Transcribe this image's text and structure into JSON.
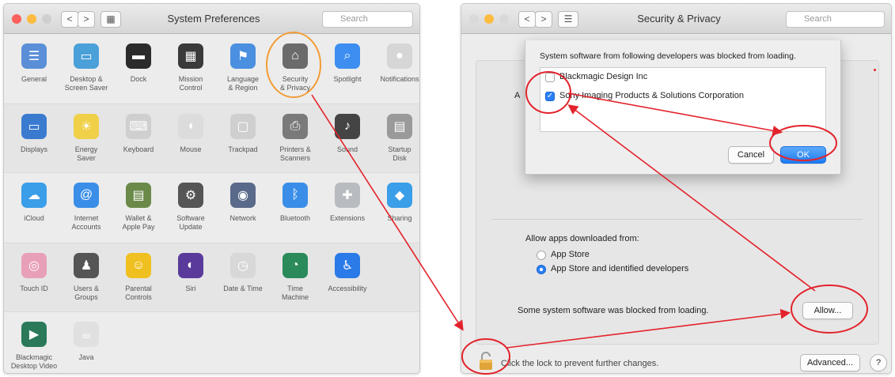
{
  "colors": {
    "close": "#fc605b",
    "minimize": "#fdbc40",
    "zoom": "#34c84a",
    "annotation_red": "#e3232c",
    "highlight_orange": "#f39c34",
    "accent_blue": "#2b7ff6"
  },
  "syspref": {
    "title": "System Preferences",
    "nav_back": "<",
    "nav_forward": ">",
    "grid_glyph": "▦",
    "search_placeholder": "Search",
    "search_icon": "search-icon",
    "rows": [
      [
        {
          "label": "General",
          "icon": "general-icon",
          "color": "#5a8fd8",
          "glyph": "☰"
        },
        {
          "label": "Desktop &\nScreen Saver",
          "icon": "desktop-icon",
          "color": "#4aa0d8",
          "glyph": "▭"
        },
        {
          "label": "Dock",
          "icon": "dock-icon",
          "color": "#2b2b2b",
          "glyph": "▬"
        },
        {
          "label": "Mission\nControl",
          "icon": "mission-control-icon",
          "color": "#3a3a3a",
          "glyph": "▦"
        },
        {
          "label": "Language\n& Region",
          "icon": "language-icon",
          "color": "#4a8fe0",
          "glyph": "⚑"
        },
        {
          "label": "Security\n& Privacy",
          "icon": "security-icon",
          "color": "#6b6b6b",
          "glyph": "⌂"
        },
        {
          "label": "Spotlight",
          "icon": "spotlight-icon",
          "color": "#3d8ef0",
          "glyph": "⌕"
        },
        {
          "label": "Notifications",
          "icon": "notifications-icon",
          "color": "#d6d6d6",
          "glyph": "●"
        }
      ],
      [
        {
          "label": "Displays",
          "icon": "displays-icon",
          "color": "#3a7bd0",
          "glyph": "▭"
        },
        {
          "label": "Energy\nSaver",
          "icon": "energy-saver-icon",
          "color": "#f0d048",
          "glyph": "☀"
        },
        {
          "label": "Keyboard",
          "icon": "keyboard-icon",
          "color": "#cfcfcf",
          "glyph": "⌨"
        },
        {
          "label": "Mouse",
          "icon": "mouse-icon",
          "color": "#dcdcdc",
          "glyph": "◖"
        },
        {
          "label": "Trackpad",
          "icon": "trackpad-icon",
          "color": "#cfcfcf",
          "glyph": "▢"
        },
        {
          "label": "Printers &\nScanners",
          "icon": "printers-icon",
          "color": "#7a7a7a",
          "glyph": "⎙"
        },
        {
          "label": "Sound",
          "icon": "sound-icon",
          "color": "#444444",
          "glyph": "♪"
        },
        {
          "label": "Startup\nDisk",
          "icon": "startup-disk-icon",
          "color": "#9a9a9a",
          "glyph": "▤"
        }
      ],
      [
        {
          "label": "iCloud",
          "icon": "icloud-icon",
          "color": "#3a9ee8",
          "glyph": "☁"
        },
        {
          "label": "Internet\nAccounts",
          "icon": "internet-accounts-icon",
          "color": "#3a8ee8",
          "glyph": "@"
        },
        {
          "label": "Wallet &\nApple Pay",
          "icon": "wallet-icon",
          "color": "#6b8a4a",
          "glyph": "▤"
        },
        {
          "label": "Software\nUpdate",
          "icon": "software-update-icon",
          "color": "#555555",
          "glyph": "⚙"
        },
        {
          "label": "Network",
          "icon": "network-icon",
          "color": "#5a6a8a",
          "glyph": "◉"
        },
        {
          "label": "Bluetooth",
          "icon": "bluetooth-icon",
          "color": "#3a8ee8",
          "glyph": "ᛒ"
        },
        {
          "label": "Extensions",
          "icon": "extensions-icon",
          "color": "#b8bcc0",
          "glyph": "✚"
        },
        {
          "label": "Sharing",
          "icon": "sharing-icon",
          "color": "#3a9ee8",
          "glyph": "◆"
        }
      ],
      [
        {
          "label": "Touch ID",
          "icon": "touch-id-icon",
          "color": "#e8a0b8",
          "glyph": "◎"
        },
        {
          "label": "Users &\nGroups",
          "icon": "users-icon",
          "color": "#555555",
          "glyph": "♟"
        },
        {
          "label": "Parental\nControls",
          "icon": "parental-controls-icon",
          "color": "#f0c020",
          "glyph": "☺"
        },
        {
          "label": "Siri",
          "icon": "siri-icon",
          "color": "#5a3a9a",
          "glyph": "◐"
        },
        {
          "label": "Date & Time",
          "icon": "date-time-icon",
          "color": "#d8d8d8",
          "glyph": "◷"
        },
        {
          "label": "Time\nMachine",
          "icon": "time-machine-icon",
          "color": "#2a8a5a",
          "glyph": "◔"
        },
        {
          "label": "Accessibility",
          "icon": "accessibility-icon",
          "color": "#2a7ae8",
          "glyph": "♿"
        }
      ],
      [
        {
          "label": "Blackmagic\nDesktop Video",
          "icon": "blackmagic-icon",
          "color": "#2a7a5a",
          "glyph": "▶"
        },
        {
          "label": "Java",
          "icon": "java-icon",
          "color": "#e0e0e0",
          "glyph": "☕"
        }
      ]
    ]
  },
  "security": {
    "title": "Security & Privacy",
    "nav_back": "<",
    "nav_forward": ">",
    "grid_glyph": "☰",
    "search_placeholder": "Search",
    "search_icon": "search-icon",
    "panel_letter": "A",
    "allow_apps_label": "Allow apps downloaded from:",
    "radio_app_store": "App Store",
    "radio_identified": "App Store and identified developers",
    "blocked_text": "Some system software was blocked from loading.",
    "allow_button": "Allow...",
    "lock_text": "Click the lock to prevent further changes.",
    "advanced_button": "Advanced...",
    "help_button": "?",
    "sheet": {
      "message": "System software from following developers was blocked from loading.",
      "developers": [
        {
          "name": "Blackmagic Design Inc",
          "checked": false
        },
        {
          "name": "Sony Imaging Products & Solutions Corporation",
          "checked": true
        }
      ],
      "cancel_button": "Cancel",
      "ok_button": "OK"
    }
  }
}
